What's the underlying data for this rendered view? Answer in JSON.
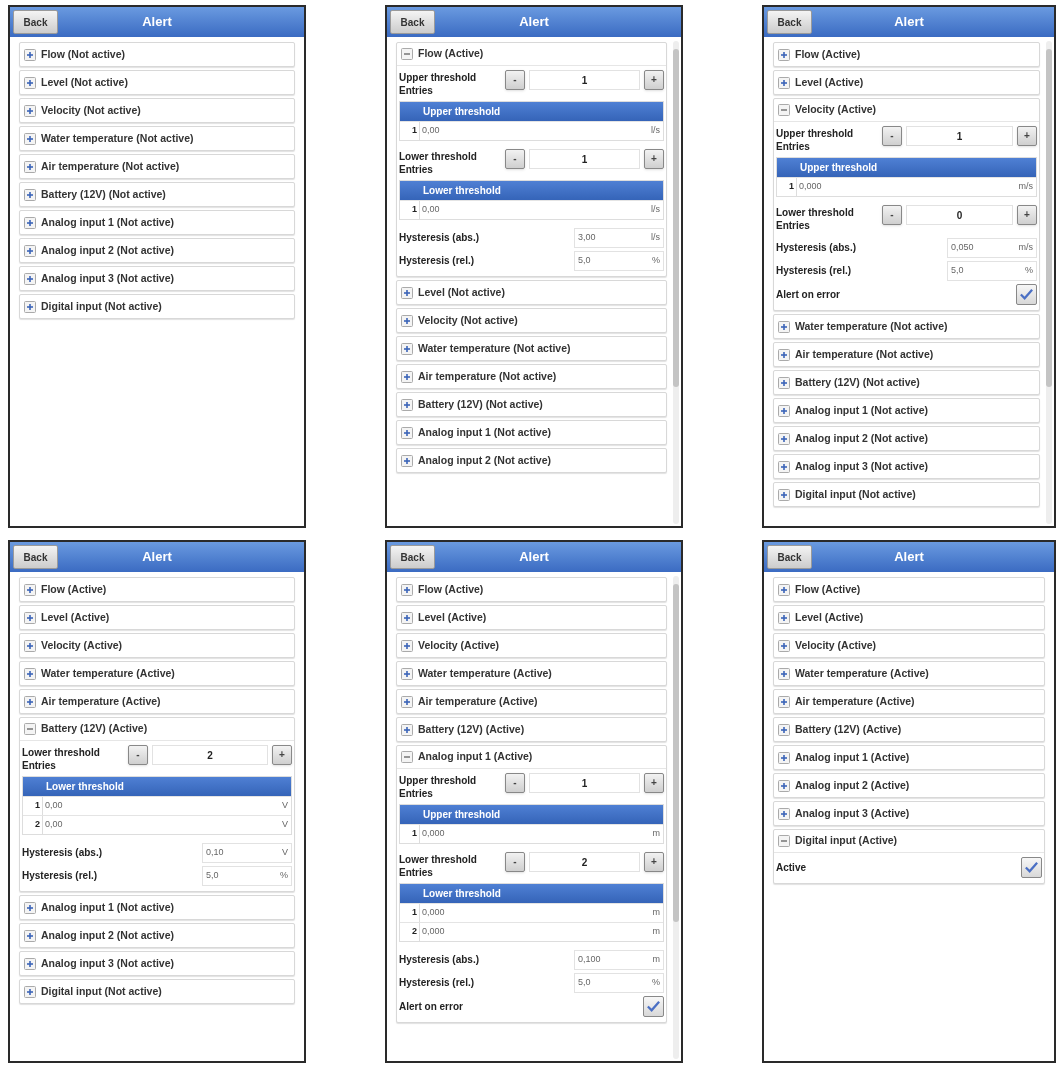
{
  "screens": [
    {
      "back": "Back",
      "title": "Alert",
      "scrollable": false,
      "sections": [
        {
          "label": "Flow (Not active)",
          "expanded": false
        },
        {
          "label": "Level (Not active)",
          "expanded": false
        },
        {
          "label": "Velocity (Not active)",
          "expanded": false
        },
        {
          "label": "Water temperature (Not active)",
          "expanded": false
        },
        {
          "label": "Air temperature (Not active)",
          "expanded": false
        },
        {
          "label": "Battery (12V) (Not active)",
          "expanded": false
        },
        {
          "label": "Analog input 1 (Not active)",
          "expanded": false
        },
        {
          "label": "Analog input 2 (Not active)",
          "expanded": false
        },
        {
          "label": "Analog input 3 (Not active)",
          "expanded": false
        },
        {
          "label": "Digital input (Not active)",
          "expanded": false
        }
      ]
    },
    {
      "back": "Back",
      "title": "Alert",
      "scrollable": true,
      "sections": [
        {
          "label": "Flow (Active)",
          "expanded": true,
          "fields": [
            {
              "kind": "stepper",
              "label": "Upper threshold",
              "sublabel": "Entries",
              "minus": "-",
              "value": "1",
              "plus": "+"
            },
            {
              "kind": "table",
              "header": "Upper threshold",
              "rows": [
                {
                  "index": "1",
                  "value": "0,00",
                  "unit": "l/s"
                }
              ]
            },
            {
              "kind": "stepper",
              "label": "Lower threshold",
              "sublabel": "Entries",
              "minus": "-",
              "value": "1",
              "plus": "+"
            },
            {
              "kind": "table",
              "header": "Lower threshold",
              "rows": [
                {
                  "index": "1",
                  "value": "0,00",
                  "unit": "l/s"
                }
              ]
            },
            {
              "kind": "number",
              "label": "Hysteresis (abs.)",
              "value": "3,00",
              "unit": "l/s"
            },
            {
              "kind": "number",
              "label": "Hysteresis (rel.)",
              "value": "5,0",
              "unit": "%"
            }
          ]
        },
        {
          "label": "Level (Not active)",
          "expanded": false
        },
        {
          "label": "Velocity (Not active)",
          "expanded": false
        },
        {
          "label": "Water temperature (Not active)",
          "expanded": false
        },
        {
          "label": "Air temperature (Not active)",
          "expanded": false
        },
        {
          "label": "Battery (12V) (Not active)",
          "expanded": false
        },
        {
          "label": "Analog input 1 (Not active)",
          "expanded": false
        },
        {
          "label": "Analog input 2 (Not active)",
          "expanded": false
        }
      ]
    },
    {
      "back": "Back",
      "title": "Alert",
      "scrollable": true,
      "sections": [
        {
          "label": "Flow (Active)",
          "expanded": false
        },
        {
          "label": "Level (Active)",
          "expanded": false
        },
        {
          "label": "Velocity (Active)",
          "expanded": true,
          "fields": [
            {
              "kind": "stepper",
              "label": "Upper threshold",
              "sublabel": "Entries",
              "minus": "-",
              "value": "1",
              "plus": "+"
            },
            {
              "kind": "table",
              "header": "Upper threshold",
              "rows": [
                {
                  "index": "1",
                  "value": "0,000",
                  "unit": "m/s"
                }
              ]
            },
            {
              "kind": "stepper",
              "label": "Lower threshold",
              "sublabel": "Entries",
              "minus": "-",
              "value": "0",
              "plus": "+"
            },
            {
              "kind": "number",
              "label": "Hysteresis (abs.)",
              "value": "0,050",
              "unit": "m/s"
            },
            {
              "kind": "number",
              "label": "Hysteresis (rel.)",
              "value": "5,0",
              "unit": "%"
            },
            {
              "kind": "checkbox",
              "label": "Alert on error",
              "checked": true
            }
          ]
        },
        {
          "label": "Water temperature (Not active)",
          "expanded": false
        },
        {
          "label": "Air temperature (Not active)",
          "expanded": false
        },
        {
          "label": "Battery (12V) (Not active)",
          "expanded": false
        },
        {
          "label": "Analog input 1 (Not active)",
          "expanded": false
        },
        {
          "label": "Analog input 2 (Not active)",
          "expanded": false
        },
        {
          "label": "Analog input 3 (Not active)",
          "expanded": false
        },
        {
          "label": "Digital input (Not active)",
          "expanded": false
        }
      ]
    },
    {
      "back": "Back",
      "title": "Alert",
      "scrollable": false,
      "sections": [
        {
          "label": "Flow (Active)",
          "expanded": false
        },
        {
          "label": "Level (Active)",
          "expanded": false
        },
        {
          "label": "Velocity (Active)",
          "expanded": false
        },
        {
          "label": "Water temperature (Active)",
          "expanded": false
        },
        {
          "label": "Air temperature (Active)",
          "expanded": false
        },
        {
          "label": "Battery (12V) (Active)",
          "expanded": true,
          "fields": [
            {
              "kind": "stepper",
              "label": "Lower threshold",
              "sublabel": "Entries",
              "minus": "-",
              "value": "2",
              "plus": "+"
            },
            {
              "kind": "table",
              "header": "Lower threshold",
              "rows": [
                {
                  "index": "1",
                  "value": "0,00",
                  "unit": "V"
                },
                {
                  "index": "2",
                  "value": "0,00",
                  "unit": "V"
                }
              ]
            },
            {
              "kind": "number",
              "label": "Hysteresis (abs.)",
              "value": "0,10",
              "unit": "V"
            },
            {
              "kind": "number",
              "label": "Hysteresis (rel.)",
              "value": "5,0",
              "unit": "%"
            }
          ]
        },
        {
          "label": "Analog input 1 (Not active)",
          "expanded": false
        },
        {
          "label": "Analog input 2 (Not active)",
          "expanded": false
        },
        {
          "label": "Analog input 3 (Not active)",
          "expanded": false
        },
        {
          "label": "Digital input (Not active)",
          "expanded": false
        }
      ]
    },
    {
      "back": "Back",
      "title": "Alert",
      "scrollable": true,
      "sections": [
        {
          "label": "Flow (Active)",
          "expanded": false
        },
        {
          "label": "Level (Active)",
          "expanded": false
        },
        {
          "label": "Velocity (Active)",
          "expanded": false
        },
        {
          "label": "Water temperature (Active)",
          "expanded": false
        },
        {
          "label": "Air temperature (Active)",
          "expanded": false
        },
        {
          "label": "Battery (12V) (Active)",
          "expanded": false
        },
        {
          "label": "Analog input 1 (Active)",
          "expanded": true,
          "fields": [
            {
              "kind": "stepper",
              "label": "Upper threshold",
              "sublabel": "Entries",
              "minus": "-",
              "value": "1",
              "plus": "+"
            },
            {
              "kind": "table",
              "header": "Upper threshold",
              "rows": [
                {
                  "index": "1",
                  "value": "0,000",
                  "unit": "m"
                }
              ]
            },
            {
              "kind": "stepper",
              "label": "Lower threshold",
              "sublabel": "Entries",
              "minus": "-",
              "value": "2",
              "plus": "+"
            },
            {
              "kind": "table",
              "header": "Lower threshold",
              "rows": [
                {
                  "index": "1",
                  "value": "0,000",
                  "unit": "m"
                },
                {
                  "index": "2",
                  "value": "0,000",
                  "unit": "m"
                }
              ]
            },
            {
              "kind": "number",
              "label": "Hysteresis (abs.)",
              "value": "0,100",
              "unit": "m"
            },
            {
              "kind": "number",
              "label": "Hysteresis (rel.)",
              "value": "5,0",
              "unit": "%"
            },
            {
              "kind": "checkbox",
              "label": "Alert on error",
              "checked": true
            }
          ]
        }
      ]
    },
    {
      "back": "Back",
      "title": "Alert",
      "scrollable": false,
      "sections": [
        {
          "label": "Flow (Active)",
          "expanded": false
        },
        {
          "label": "Level (Active)",
          "expanded": false
        },
        {
          "label": "Velocity (Active)",
          "expanded": false
        },
        {
          "label": "Water temperature (Active)",
          "expanded": false
        },
        {
          "label": "Air temperature (Active)",
          "expanded": false
        },
        {
          "label": "Battery (12V) (Active)",
          "expanded": false
        },
        {
          "label": "Analog input 1 (Active)",
          "expanded": false
        },
        {
          "label": "Analog input 2 (Active)",
          "expanded": false
        },
        {
          "label": "Analog input 3 (Active)",
          "expanded": false
        },
        {
          "label": "Digital input (Active)",
          "expanded": true,
          "fields": [
            {
              "kind": "checkbox",
              "label": "Active",
              "checked": true
            }
          ]
        }
      ]
    }
  ]
}
